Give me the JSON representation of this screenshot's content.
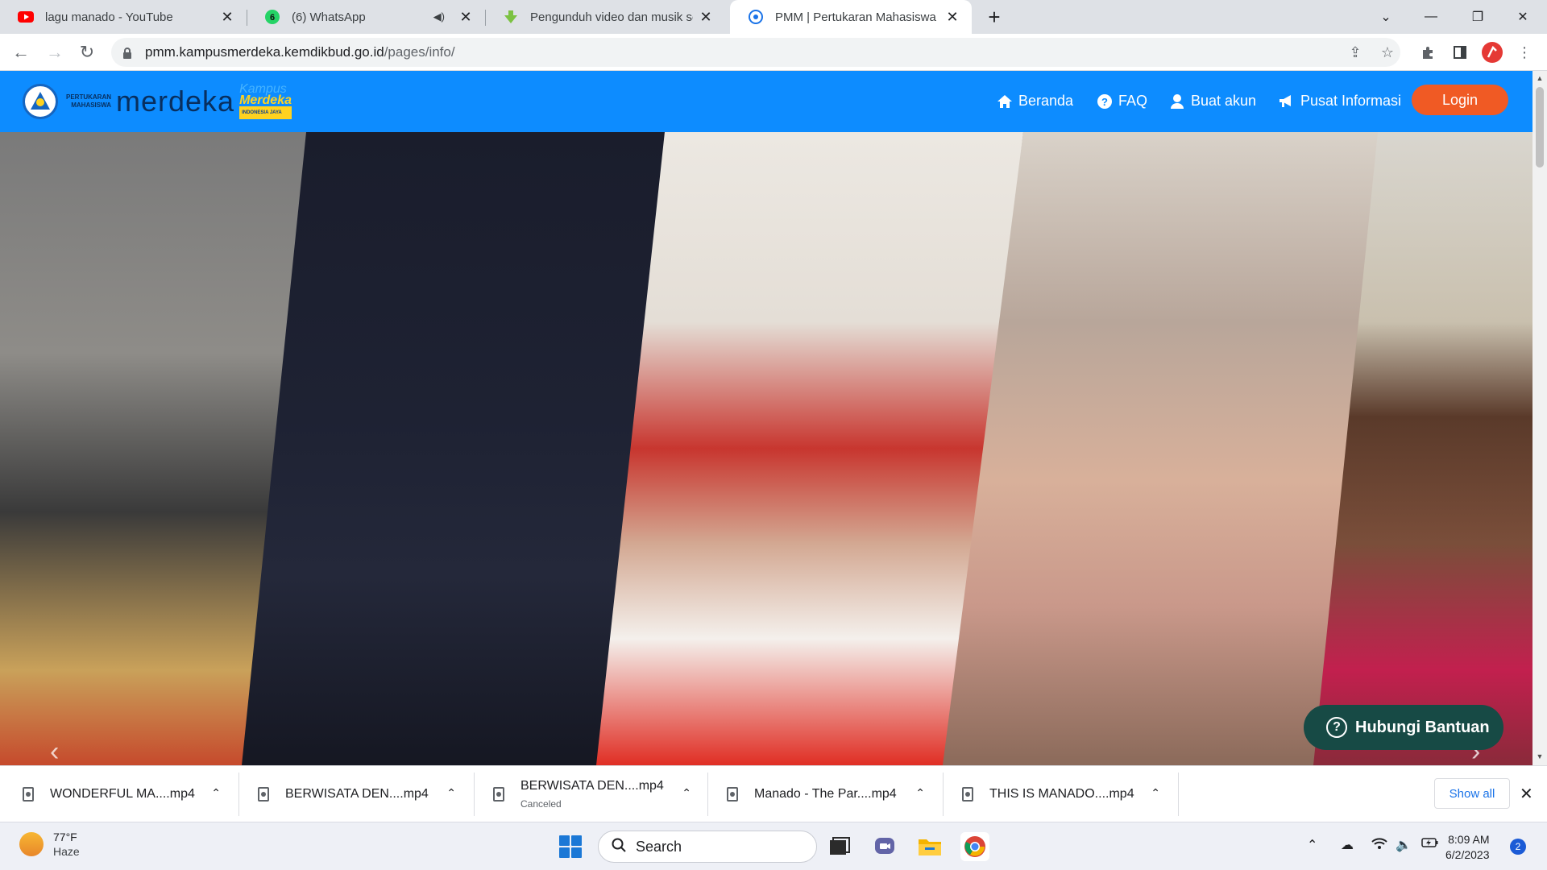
{
  "browser": {
    "tabs": [
      {
        "title": "lagu manado - YouTube",
        "icon": "youtube-icon"
      },
      {
        "title": "(6) WhatsApp",
        "icon": "whatsapp-icon",
        "badge": "6"
      },
      {
        "title": "Pengunduh video dan musik seca",
        "icon": "download-site-icon"
      },
      {
        "title": "PMM | Pertukaran Mahasiswa Me",
        "icon": "kemdikbud-icon"
      }
    ],
    "new_tab": "+",
    "url_host": "pmm.kampusmerdeka.kemdikbud.go.id",
    "url_path": "/pages/info/"
  },
  "site": {
    "logo": {
      "line1": "PERTUKARAN",
      "line2": "MAHASISWA",
      "brand": "merdeka",
      "km1": "Kampus",
      "km2": "Merdeka",
      "km3": "INDONESIA JAYA"
    },
    "nav": {
      "beranda": "Beranda",
      "faq": "FAQ",
      "buat_akun": "Buat akun",
      "pusat_informasi": "Pusat Informasi",
      "login": "Login"
    },
    "help_button": "Hubungi Bantuan",
    "colors": {
      "nav": "#0d8cff",
      "login": "#f05a24",
      "help": "#174a45"
    }
  },
  "downloads": {
    "items": [
      {
        "name": "WONDERFUL MA....mp4",
        "status": ""
      },
      {
        "name": "BERWISATA DEN....mp4",
        "status": ""
      },
      {
        "name": "BERWISATA DEN....mp4",
        "status": "Canceled"
      },
      {
        "name": "Manado - The Par....mp4",
        "status": ""
      },
      {
        "name": "THIS IS MANADO....mp4",
        "status": ""
      }
    ],
    "show_all": "Show all"
  },
  "taskbar": {
    "temperature": "77°F",
    "weather": "Haze",
    "search_label": "Search",
    "time": "8:09 AM",
    "date": "6/2/2023",
    "notification_count": "2"
  }
}
